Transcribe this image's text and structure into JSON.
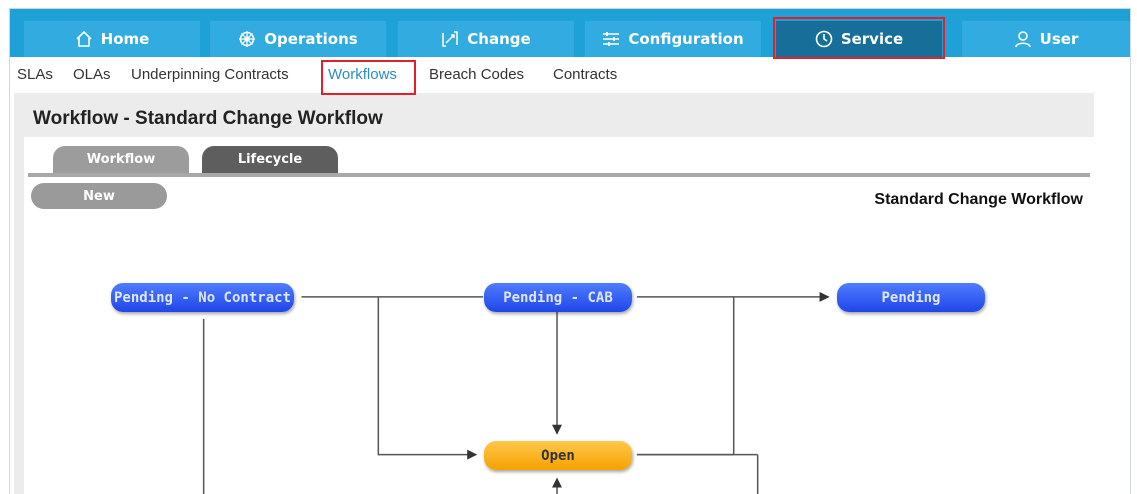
{
  "nav": {
    "items": [
      {
        "label": "Home",
        "icon": "home-icon"
      },
      {
        "label": "Operations",
        "icon": "gear-wheel-icon"
      },
      {
        "label": "Change",
        "icon": "change-icon"
      },
      {
        "label": "Configuration",
        "icon": "sliders-icon"
      },
      {
        "label": "Service",
        "icon": "clock-icon",
        "active": true
      },
      {
        "label": "User",
        "icon": "user-icon"
      }
    ]
  },
  "subnav": {
    "items": [
      {
        "label": "SLAs"
      },
      {
        "label": "OLAs"
      },
      {
        "label": "Underpinning Contracts"
      },
      {
        "label": "Workflows",
        "active": true
      },
      {
        "label": "Breach Codes"
      },
      {
        "label": "Contracts"
      }
    ]
  },
  "page": {
    "title": "Workflow - Standard Change Workflow",
    "tabs": [
      {
        "label": "Workflow"
      },
      {
        "label": "Lifecycle",
        "active": true
      }
    ],
    "new_label": "New",
    "workflow_name": "Standard Change Workflow"
  },
  "diagram": {
    "nodes": [
      {
        "id": "pending-no-contract",
        "label": "Pending - No Contract",
        "color": "#2f58f5"
      },
      {
        "id": "pending-cab",
        "label": "Pending - CAB",
        "color": "#2f58f5"
      },
      {
        "id": "pending",
        "label": "Pending",
        "color": "#2f58f5"
      },
      {
        "id": "open",
        "label": "Open",
        "color": "#f9b01c"
      }
    ]
  },
  "colors": {
    "nav_bg": "#1ea1d6",
    "nav_active": "#176f99",
    "highlight": "#e3202a",
    "subnav_active": "#2a8ec2"
  }
}
